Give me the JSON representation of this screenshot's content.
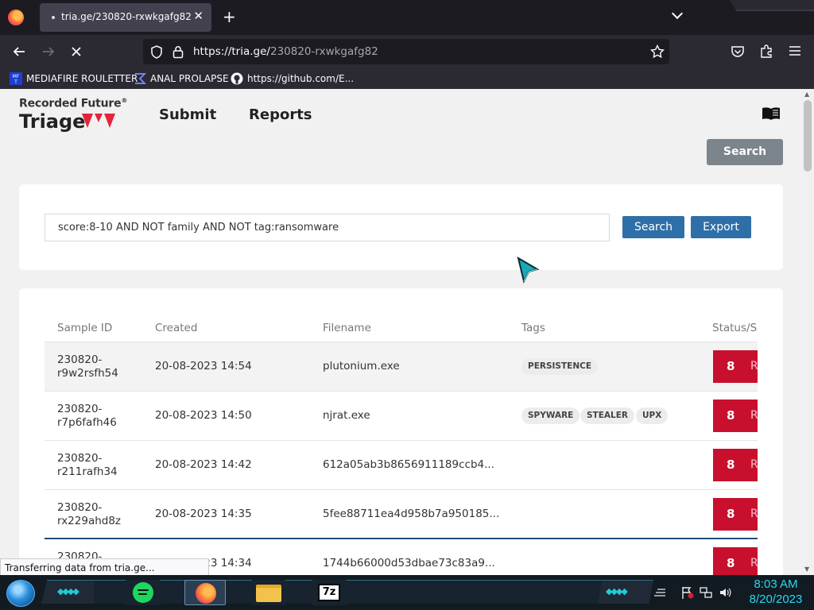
{
  "browser": {
    "tab_title": "tria.ge/230820-rxwkgafg82",
    "tab_close": "✕",
    "new_tab": "+",
    "url_host": "https://tria.ge/",
    "url_path": "230820-rxwkgafg82",
    "bookmarks": [
      {
        "label": "MEDIAFIRE ROULETTER",
        "icon": "mediafire-icon"
      },
      {
        "label": "ANAL PROLAPSE",
        "icon": "sigma-icon"
      },
      {
        "label": "https://github.com/E...",
        "icon": "github-icon"
      }
    ],
    "status_text": "Transferring data from tria.ge..."
  },
  "header": {
    "brand_top": "Recorded Future",
    "brand_reg": "®",
    "brand_bottom": "Triage",
    "nav": [
      "Submit",
      "Reports"
    ],
    "search_button": "Search"
  },
  "search": {
    "query": "score:8-10 AND NOT family AND NOT tag:ransomware",
    "search_label": "Search",
    "export_label": "Export"
  },
  "table": {
    "columns": [
      "Sample ID",
      "Created",
      "Filename",
      "Tags",
      "Status/S"
    ],
    "rows": [
      {
        "id_line1": "230820-",
        "id_line2": "r9w2rsfh54",
        "created": "20-08-2023 14:54",
        "filename": "plutonium.exe",
        "tags": [
          "PERSISTENCE"
        ],
        "score": "8",
        "status": "R"
      },
      {
        "id_line1": "230820-",
        "id_line2": "r7p6fafh46",
        "created": "20-08-2023 14:50",
        "filename": "njrat.exe",
        "tags": [
          "SPYWARE",
          "STEALER",
          "UPX"
        ],
        "score": "8",
        "status": "R"
      },
      {
        "id_line1": "230820-",
        "id_line2": "r211rafh34",
        "created": "20-08-2023 14:42",
        "filename": "612a05ab3b8656911189ccb4...",
        "tags": [],
        "score": "8",
        "status": "R"
      },
      {
        "id_line1": "230820-",
        "id_line2": "rx229ahd8z",
        "created": "20-08-2023 14:35",
        "filename": "5fee88711ea4d958b7a950185...",
        "tags": [],
        "score": "8",
        "status": "R"
      },
      {
        "id_line1": "230820-",
        "id_line2": "",
        "created": "20-08-2023 14:34",
        "filename": "1744b66000d53dbae73c83a9...",
        "tags": [],
        "score": "8",
        "status": "R"
      }
    ]
  },
  "taskbar": {
    "time": "8:03 AM",
    "date": "8/20/2023",
    "seven_zip": "7z"
  },
  "colors": {
    "score_red": "#c8102e",
    "button_blue": "#2f6fa8",
    "brand_red": "#e5243b",
    "clock_cyan": "#2ad7f0"
  }
}
